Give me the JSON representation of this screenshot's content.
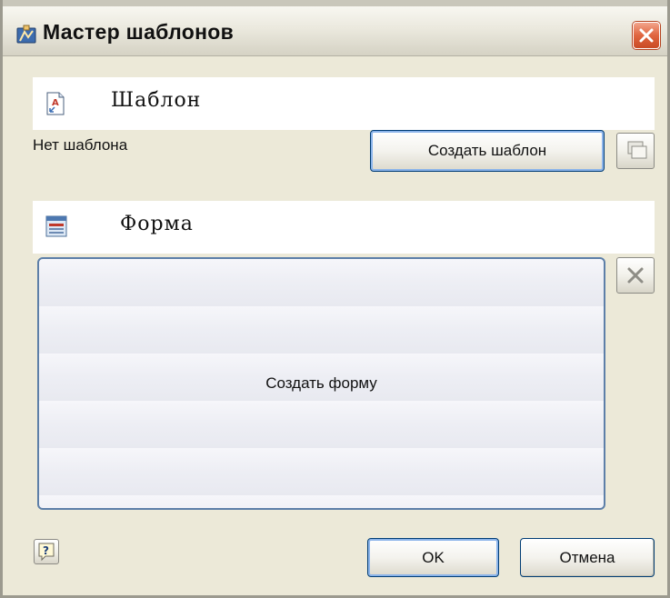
{
  "window": {
    "title": "Мастер шаблонов",
    "icon": "template-wizard-icon"
  },
  "template_section": {
    "heading": "Шаблон",
    "icon": "template-document-icon",
    "status": "Нет шаблона",
    "create_button": "Создать шаблон",
    "copy_icon": "copy-icon"
  },
  "form_section": {
    "heading": "Форма",
    "icon": "form-icon",
    "create_form_label": "Создать форму",
    "delete_icon": "delete-icon"
  },
  "footer": {
    "help_icon": "help-icon",
    "ok_label": "OK",
    "cancel_label": "Отмена"
  },
  "colors": {
    "dialog_bg": "#ece9d8",
    "close_button": "#e0653f",
    "button_border": "#003c74",
    "form_border": "#5d7fa8"
  }
}
